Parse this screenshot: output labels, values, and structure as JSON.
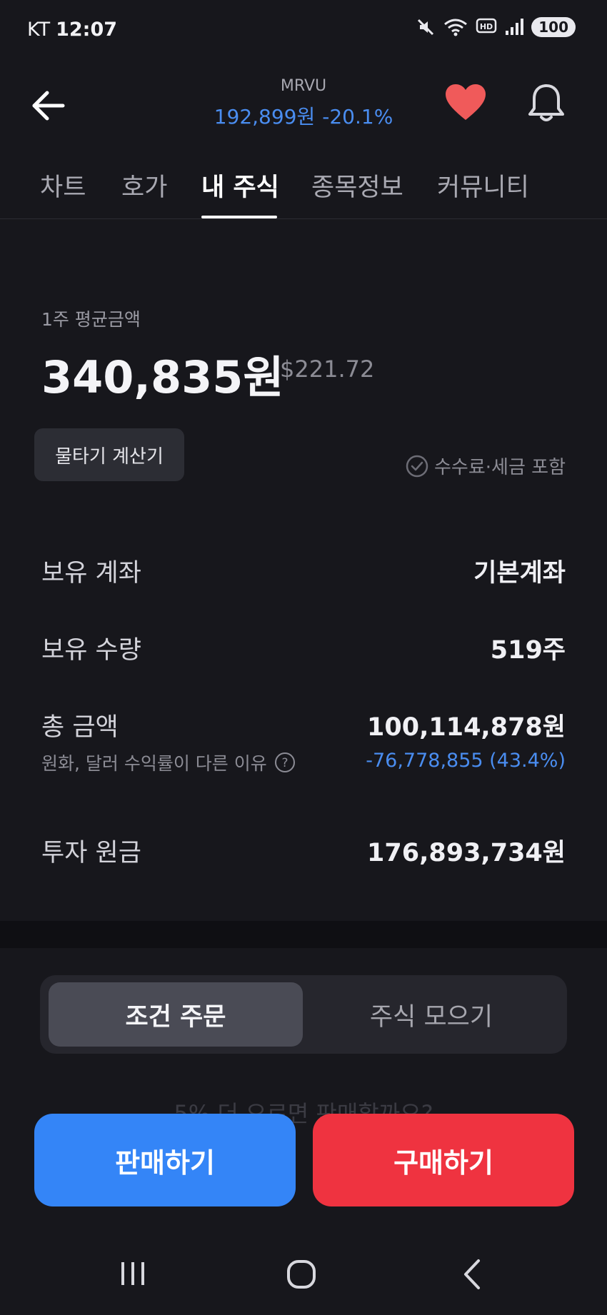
{
  "status_bar": {
    "carrier": "KT",
    "time": "12:07",
    "battery": "100"
  },
  "header": {
    "ticker": "MRVU",
    "price": "192,899원",
    "change": "-20.1%"
  },
  "tabs": [
    {
      "label": "차트"
    },
    {
      "label": "호가"
    },
    {
      "label": "내 주식"
    },
    {
      "label": "종목정보"
    },
    {
      "label": "커뮤니티"
    }
  ],
  "average": {
    "label": "1주 평균금액",
    "price_krw": "340,835원",
    "price_usd": "$221.72",
    "calc_button": "물타기 계산기",
    "fee_note": "수수료·세금 포함"
  },
  "rows": {
    "account": {
      "label": "보유 계좌",
      "value": "기본계좌"
    },
    "quantity": {
      "label": "보유 수량",
      "value": "519주"
    },
    "total": {
      "label": "총 금액",
      "value": "100,114,878원",
      "sub_label": "원화, 달러 수익률이 다른 이유",
      "sub_value": "-76,778,855 (43.4%)"
    },
    "principal": {
      "label": "투자 원금",
      "value": "176,893,734원"
    }
  },
  "segment": {
    "options": [
      "조건 주문",
      "주식 모으기"
    ]
  },
  "faded_text": "5% 더 오르면 판매할까요?",
  "actions": {
    "sell": "판매하기",
    "buy": "구매하기"
  },
  "colors": {
    "accent_blue": "#3485f7",
    "accent_red": "#ef3340",
    "background": "#17171c"
  }
}
